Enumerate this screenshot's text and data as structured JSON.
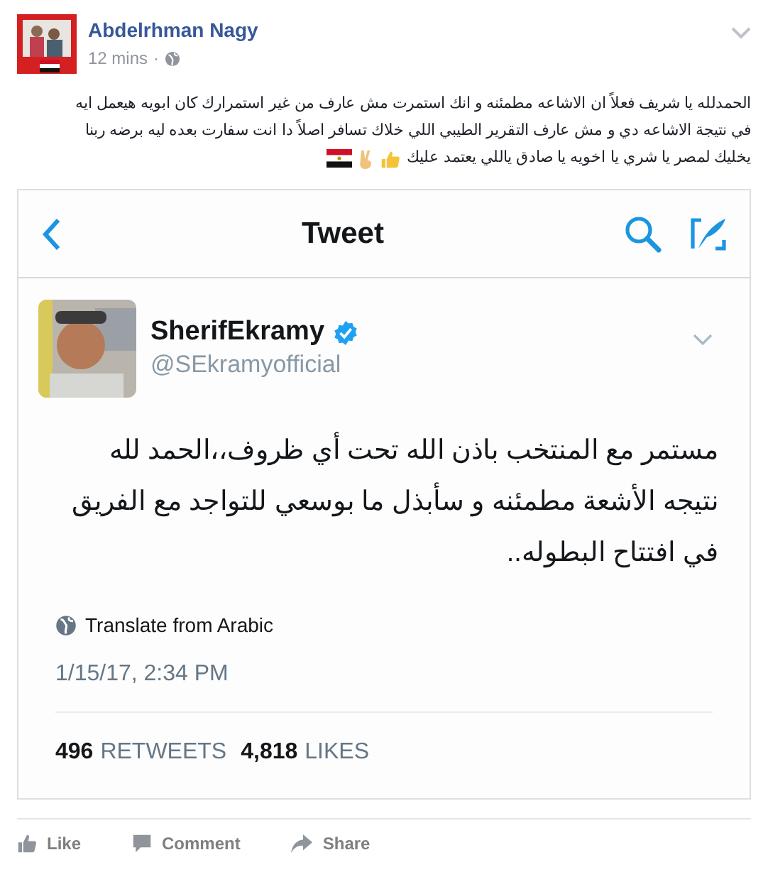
{
  "post": {
    "author": "Abdelrhman Nagy",
    "time": "12 mins",
    "separator": "·",
    "text_lines": [
      "الحمدلله يا شريف فعلاً ان الاشاعه مطمئنه و انك استمرت مش عارف من غير استمرارك كان ابويه هيعمل ايه",
      "في نتيجة الاشاعه دي و مش عارف التقرير الطيبي اللي خلاك تسافر اصلاً دا انت سفارت بعده ليه برضه ربنا",
      "يخليك لمصر يا شري يا اخويه يا صادق ياللي يعتمد عليك"
    ]
  },
  "tweet": {
    "nav_title": "Tweet",
    "name": "SherifEkramy",
    "verified": true,
    "handle": "@SEkramyofficial",
    "text": "مستمر مع المنتخب باذن الله تحت أي ظروف،،الحمد لله نتيجه الأشعة مطمئنه و سأبذل ما بوسعي للتواجد مع الفريق في افتتاح البطوله..",
    "translate": "Translate from Arabic",
    "date": "1/15/17, 2:34 PM",
    "stats": [
      {
        "count": "496",
        "label": "RETWEETS"
      },
      {
        "count": "4,818",
        "label": "LIKES"
      }
    ]
  },
  "actions": [
    "Like",
    "Comment",
    "Share"
  ]
}
